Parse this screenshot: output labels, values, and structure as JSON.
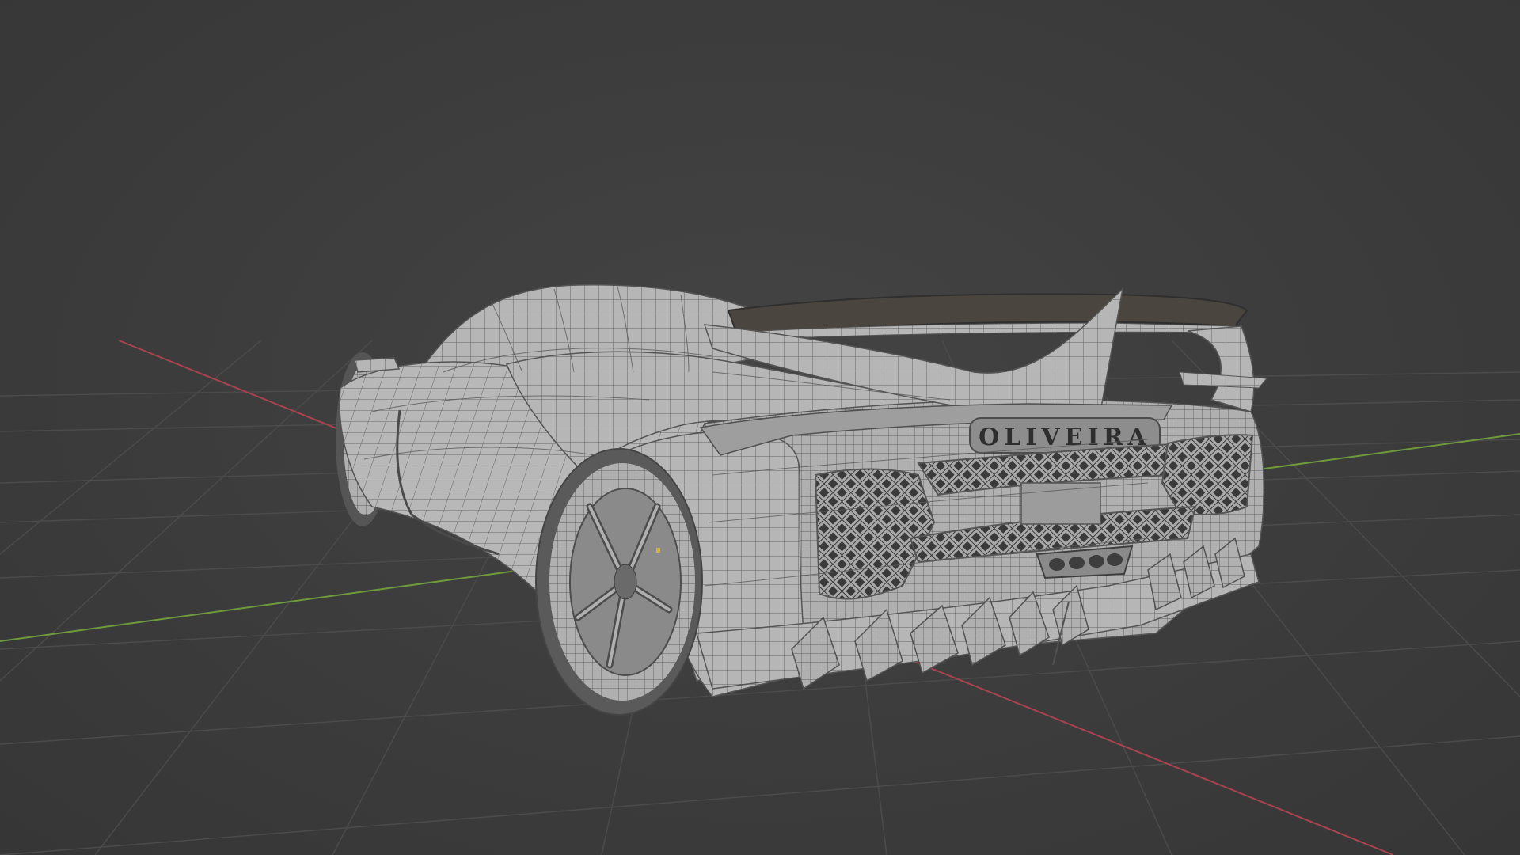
{
  "viewport": {
    "background_color": "#3d3d3d",
    "grid_color": "#4a4a4a",
    "x_axis_color": "#a8434f",
    "y_axis_color": "#6f9a3c"
  },
  "model": {
    "type": "hypercar-wireframe",
    "badge_text": "OLIVEIRA",
    "surface_color": "#b4b4b4",
    "wire_color": "#5a5a5a",
    "dark_panel_color": "#4b4540"
  }
}
